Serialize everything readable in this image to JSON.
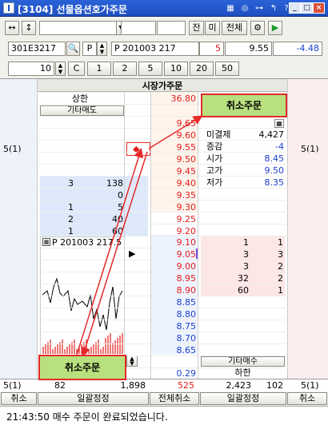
{
  "window": {
    "title": "[3104] 선물옵션호가주문",
    "app_icon": "I",
    "toolbar_icons": [
      "grid-icon",
      "circle-icon",
      "link-icon",
      "shortcut-icon",
      "help-icon"
    ],
    "buttons": [
      "minimize",
      "maximize",
      "close"
    ]
  },
  "toolbar": {
    "buttons": {
      "jan": "잔",
      "mi": "미",
      "all": "전체"
    },
    "code": "301E3217",
    "type": "P",
    "option_name": "P 201003 217",
    "qty_small": "5",
    "price": "9.55",
    "change": "-4.48"
  },
  "qty_row": {
    "qty": "10",
    "c_label": "C",
    "presets": [
      "1",
      "2",
      "5",
      "10",
      "20",
      "50"
    ]
  },
  "order_type": "시장가주문",
  "upper_limit": {
    "label": "상한",
    "value": "36.80"
  },
  "lower_limit": {
    "label": "하한",
    "value": "0.29"
  },
  "labels": {
    "etc_sell": "기타매도",
    "etc_buy": "기타매수"
  },
  "market_info": [
    {
      "label": "미결제",
      "value": "4,427"
    },
    {
      "label": "증감",
      "value": "-4"
    },
    {
      "label": "시가",
      "value": "8.45"
    },
    {
      "label": "고가",
      "value": "9.50"
    },
    {
      "label": "저가",
      "value": "8.35"
    }
  ],
  "pending_left": "5(1)",
  "pending_right": "5(1)",
  "order_marker": "◆",
  "current_marker": "▶",
  "ask_prices": [
    "9.65",
    "9.60",
    "9.55",
    "9.50",
    "9.45",
    "9.40",
    "9.35",
    "9.30",
    "9.25",
    "9.20"
  ],
  "ask_rows": [
    {
      "qty": "3",
      "amount": "138"
    },
    {
      "qty": "",
      "amount": "0"
    },
    {
      "qty": "1",
      "amount": "5"
    },
    {
      "qty": "2",
      "amount": "40"
    },
    {
      "qty": "1",
      "amount": "60"
    }
  ],
  "bid_prices": [
    "9.10",
    "9.05",
    "9.00",
    "8.95",
    "8.90",
    "8.85",
    "8.80",
    "8.75",
    "8.70",
    "8.65"
  ],
  "bid_rows": [
    {
      "amount": "1",
      "count": "1"
    },
    {
      "amount": "3",
      "count": "3"
    },
    {
      "amount": "3",
      "count": "2"
    },
    {
      "amount": "32",
      "count": "2"
    },
    {
      "amount": "60",
      "count": "1"
    }
  ],
  "mini_chart": {
    "label": "P 201003 217.5"
  },
  "totals": {
    "left_count": "5(1)",
    "sell_count": "82",
    "sell_total": "1,898",
    "net": "525",
    "buy_total": "2,423",
    "buy_count": "102",
    "right_count": "5(1)"
  },
  "bottom_buttons": {
    "cancel_l": "취소",
    "batch_l": "일괄정정",
    "cancel_all": "전체취소",
    "batch_r": "일괄정정",
    "cancel_r": "취소"
  },
  "callouts": {
    "top": "취소주문",
    "bottom": "취소주문"
  },
  "status": "21:43:50 매수 주문이 완료되었습니다.",
  "colors": {
    "title": "#1e4fc0",
    "ask_bg": "#dde9fb",
    "bid_bg": "#fde6e6",
    "callout": "#b8e07e",
    "arrow": "#e52a2a"
  }
}
